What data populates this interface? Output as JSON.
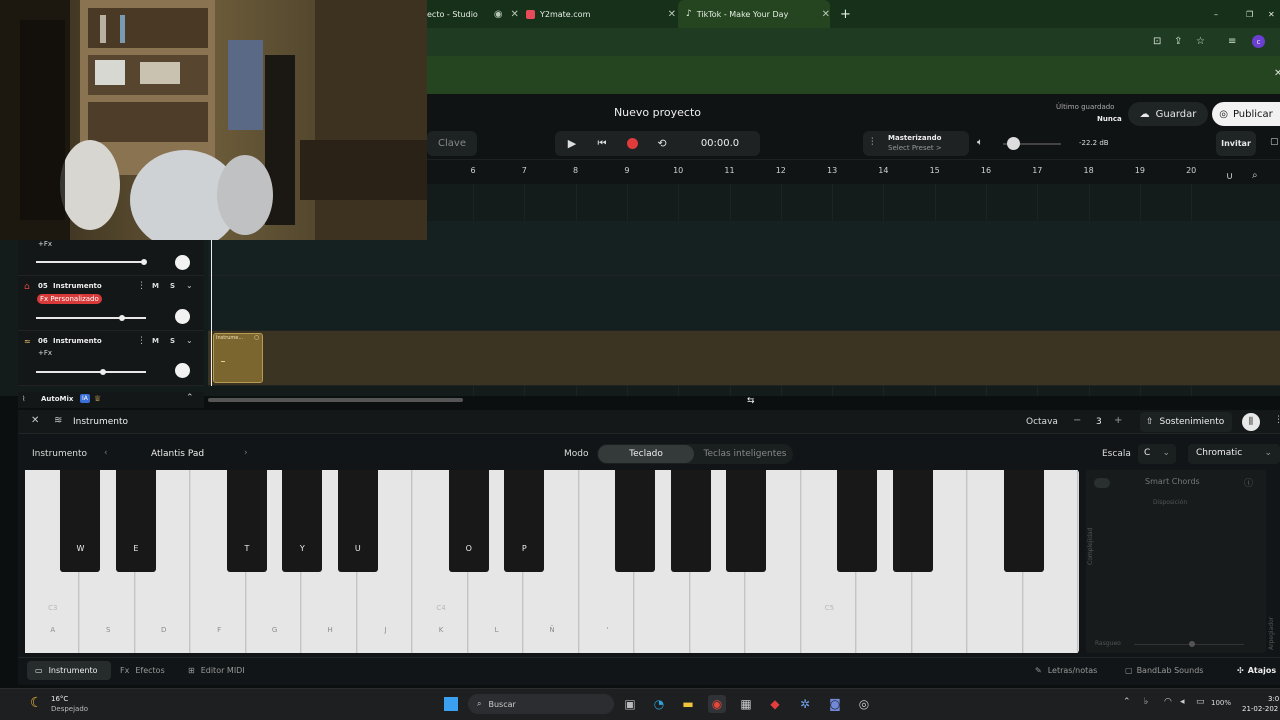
{
  "browser": {
    "tabs": [
      {
        "label": "ecto - Studio"
      },
      {
        "label": "Y2mate.com"
      },
      {
        "label": "TikTok - Make Your Day"
      }
    ],
    "new_tab": "+",
    "window_controls": [
      "–",
      "❐",
      "✕"
    ]
  },
  "header": {
    "key_label": "Clave",
    "project_title": "Nuevo proyecto",
    "timecode": "00:00.0",
    "master_title": "Masterizando",
    "master_sub": "Select Preset >",
    "db_value": "-22.2 dB",
    "last_saved_label": "Último guardado",
    "last_saved_value": "Nunca",
    "save_label": "Guardar",
    "publish_label": "Publicar",
    "invite_label": "Invitar"
  },
  "ruler": {
    "numbers": [
      "6",
      "7",
      "8",
      "9",
      "10",
      "11",
      "12",
      "13",
      "14",
      "15",
      "16",
      "17",
      "18",
      "19",
      "20"
    ]
  },
  "tracks": [
    {
      "number": "",
      "name": "",
      "fx": "+Fx",
      "fx_custom": false,
      "volume": 0.75
    },
    {
      "number": "05",
      "name": "Instrumento",
      "fx": "Fx Personalizado",
      "fx_custom": true,
      "volume": 0.5
    },
    {
      "number": "06",
      "name": "Instrumento",
      "fx": "+Fx",
      "fx_custom": false,
      "volume": 0.45
    }
  ],
  "track_buttons": {
    "mute": "M",
    "solo": "S"
  },
  "clip": {
    "label": "Instrume..."
  },
  "automix": {
    "label": "AutoMix",
    "badge": "IA"
  },
  "panel": {
    "title": "Instrumento",
    "octave_label": "Octava",
    "octave_value": "3",
    "sustain_label": "Sostenimiento",
    "instrument_label": "Instrumento",
    "instrument_value": "Atlantis Pad",
    "mode_label": "Modo",
    "mode_options": [
      "Teclado",
      "Teclas inteligentes"
    ],
    "scale_label": "Escala",
    "scale_key": "C",
    "scale_type": "Chromatic",
    "smart_chords_label": "Smart Chords",
    "disposition_label": "Disposición",
    "complexity_label": "Complejidad",
    "strum_label": "Rasgueo",
    "arpeggiator_label": "Arpegiador"
  },
  "keyboard": {
    "white_keys": [
      "A",
      "S",
      "D",
      "F",
      "G",
      "H",
      "J",
      "K",
      "L",
      "Ñ",
      "'",
      "",
      "",
      "",
      "",
      "",
      "",
      "",
      "",
      ""
    ],
    "octave_marks": [
      "C3",
      "C4",
      "C5"
    ],
    "black_keys": [
      "W",
      "E",
      "T",
      "Y",
      "U",
      "O",
      "P",
      "",
      "",
      "",
      "",
      "",
      ""
    ]
  },
  "bottom_tabs": [
    "Instrumento",
    "Efectos",
    "Editor MIDI"
  ],
  "bottom_right": [
    "Letras/notas",
    "BandLab Sounds",
    "Atajos"
  ],
  "taskbar": {
    "weather_temp": "16°C",
    "weather_desc": "Despejado",
    "search_label": "Buscar",
    "battery": "100%",
    "time": "3:0",
    "date": "21-02-202"
  }
}
